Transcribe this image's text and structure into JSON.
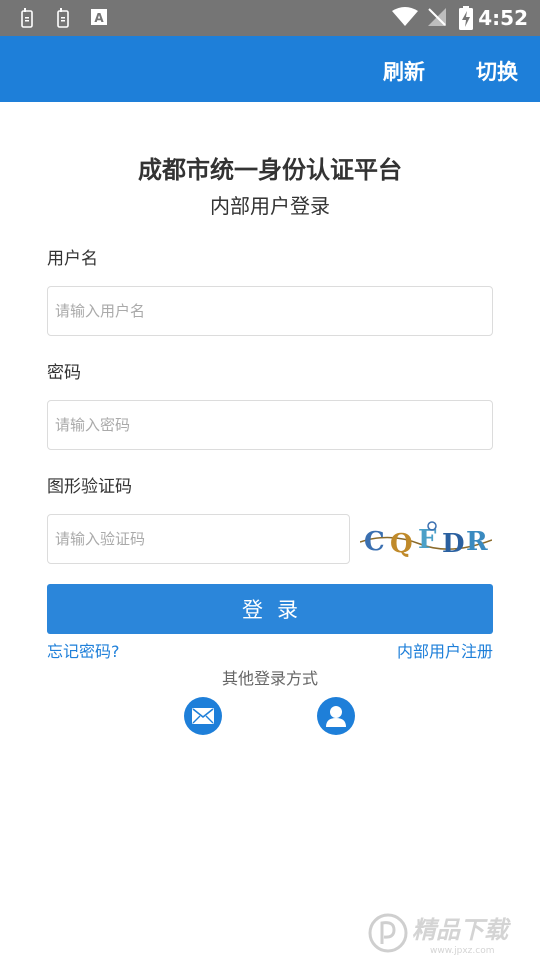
{
  "status_bar": {
    "time": "4:52",
    "icons": [
      "sim-icon",
      "sim-icon",
      "text-icon",
      "wifi-icon",
      "no-signal-icon",
      "battery-charging-icon"
    ]
  },
  "app_bar": {
    "refresh_label": "刷新",
    "switch_label": "切换"
  },
  "header": {
    "title": "成都市统一身份认证平台",
    "subtitle": "内部用户登录"
  },
  "form": {
    "username_label": "用户名",
    "username_placeholder": "请输入用户名",
    "password_label": "密码",
    "password_placeholder": "请输入密码",
    "captcha_label": "图形验证码",
    "captcha_placeholder": "请输入验证码",
    "captcha_chars": [
      "C",
      "Q",
      "F",
      "D",
      "R"
    ],
    "login_label": "登录"
  },
  "links": {
    "forgot_password": "忘记密码?",
    "register": "内部用户注册"
  },
  "other_login": {
    "label": "其他登录方式",
    "icons": [
      "mail-icon",
      "user-icon"
    ]
  },
  "watermark": {
    "text": "精品下载",
    "url_text": "www.jpxz.com"
  },
  "colors": {
    "accent": "#1e7fd9",
    "button": "#2b86da",
    "status_bar": "#757575"
  }
}
